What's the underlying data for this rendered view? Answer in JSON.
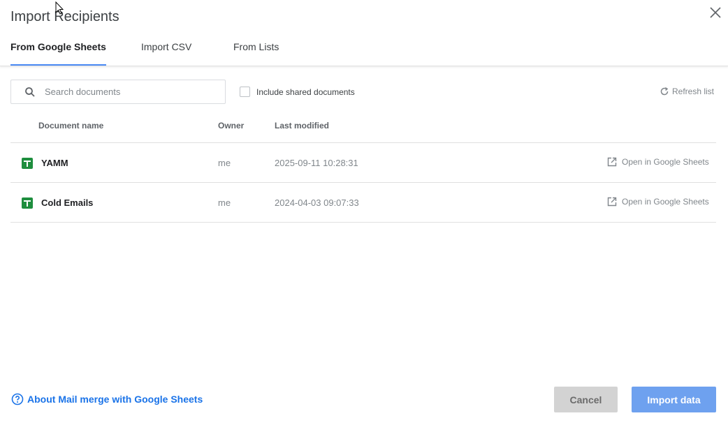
{
  "dialog": {
    "title": "Import Recipients",
    "close_icon": "close-icon"
  },
  "tabs": [
    {
      "label": "From Google Sheets",
      "active": true
    },
    {
      "label": "Import CSV",
      "active": false
    },
    {
      "label": "From Lists",
      "active": false
    }
  ],
  "toolbar": {
    "search_placeholder": "Search documents",
    "search_value": "",
    "include_shared_label": "Include shared documents",
    "include_shared_checked": false,
    "refresh_label": "Refresh list"
  },
  "table": {
    "headers": {
      "name": "Document name",
      "owner": "Owner",
      "modified": "Last modified"
    },
    "rows": [
      {
        "name": "YAMM",
        "owner": "me",
        "modified": "2025-09-11 10:28:31",
        "open_label": "Open in Google Sheets"
      },
      {
        "name": "Cold Emails",
        "owner": "me",
        "modified": "2024-04-03 09:07:33",
        "open_label": "Open in Google Sheets"
      }
    ]
  },
  "footer": {
    "help_link": "About Mail merge with Google Sheets",
    "cancel_label": "Cancel",
    "import_label": "Import data"
  },
  "colors": {
    "accent": "#1a73e8",
    "tab_indicator": "#4a8af4",
    "sheets_green": "#1e8e3e",
    "import_button": "#6ea1ef",
    "cancel_button": "#d3d3d3"
  }
}
